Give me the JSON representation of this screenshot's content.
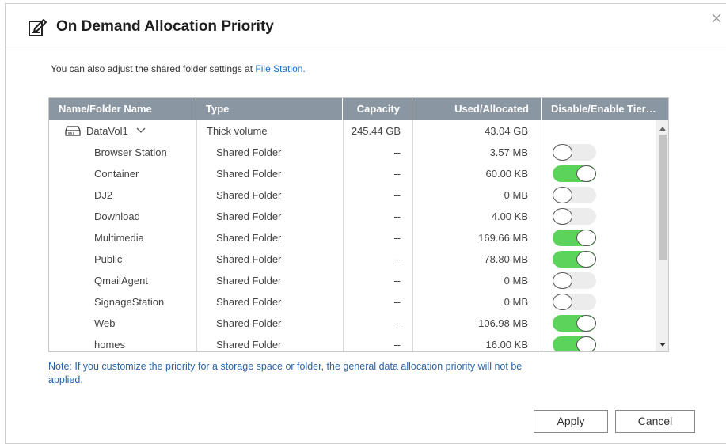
{
  "dialog": {
    "title": "On Demand Allocation Priority",
    "icon": "edit-note-icon"
  },
  "info": {
    "text": "You can also adjust the shared folder settings at ",
    "link": "File Station."
  },
  "table": {
    "columns": [
      "Name/Folder Name",
      "Type",
      "Capacity",
      "Used/Allocated",
      "Disable/Enable Tier…"
    ],
    "volume": {
      "name": "DataVol1",
      "type": "Thick volume",
      "capacity": "245.44 GB",
      "used": "43.04 GB"
    },
    "rows": [
      {
        "name": "Browser Station",
        "type": "Shared Folder",
        "capacity": "--",
        "used": "3.57 MB",
        "enabled": false
      },
      {
        "name": "Container",
        "type": "Shared Folder",
        "capacity": "--",
        "used": "60.00 KB",
        "enabled": true
      },
      {
        "name": "DJ2",
        "type": "Shared Folder",
        "capacity": "--",
        "used": "0 MB",
        "enabled": false
      },
      {
        "name": "Download",
        "type": "Shared Folder",
        "capacity": "--",
        "used": "4.00 KB",
        "enabled": false
      },
      {
        "name": "Multimedia",
        "type": "Shared Folder",
        "capacity": "--",
        "used": "169.66 MB",
        "enabled": true
      },
      {
        "name": "Public",
        "type": "Shared Folder",
        "capacity": "--",
        "used": "78.80 MB",
        "enabled": true
      },
      {
        "name": "QmailAgent",
        "type": "Shared Folder",
        "capacity": "--",
        "used": "0 MB",
        "enabled": false
      },
      {
        "name": "SignageStation",
        "type": "Shared Folder",
        "capacity": "--",
        "used": "0 MB",
        "enabled": false
      },
      {
        "name": "Web",
        "type": "Shared Folder",
        "capacity": "--",
        "used": "106.98 MB",
        "enabled": true
      },
      {
        "name": "homes",
        "type": "Shared Folder",
        "capacity": "--",
        "used": "16.00 KB",
        "enabled": true
      }
    ]
  },
  "note": "Note: If you customize the priority for a storage space or folder, the general data allocation priority will not be applied.",
  "buttons": {
    "apply": "Apply",
    "cancel": "Cancel"
  },
  "colors": {
    "header_bg": "#8b96a3",
    "toggle_on": "#5cd35a",
    "toggle_off": "#ececec",
    "link": "#1a73c8",
    "note": "#2a64a8"
  }
}
